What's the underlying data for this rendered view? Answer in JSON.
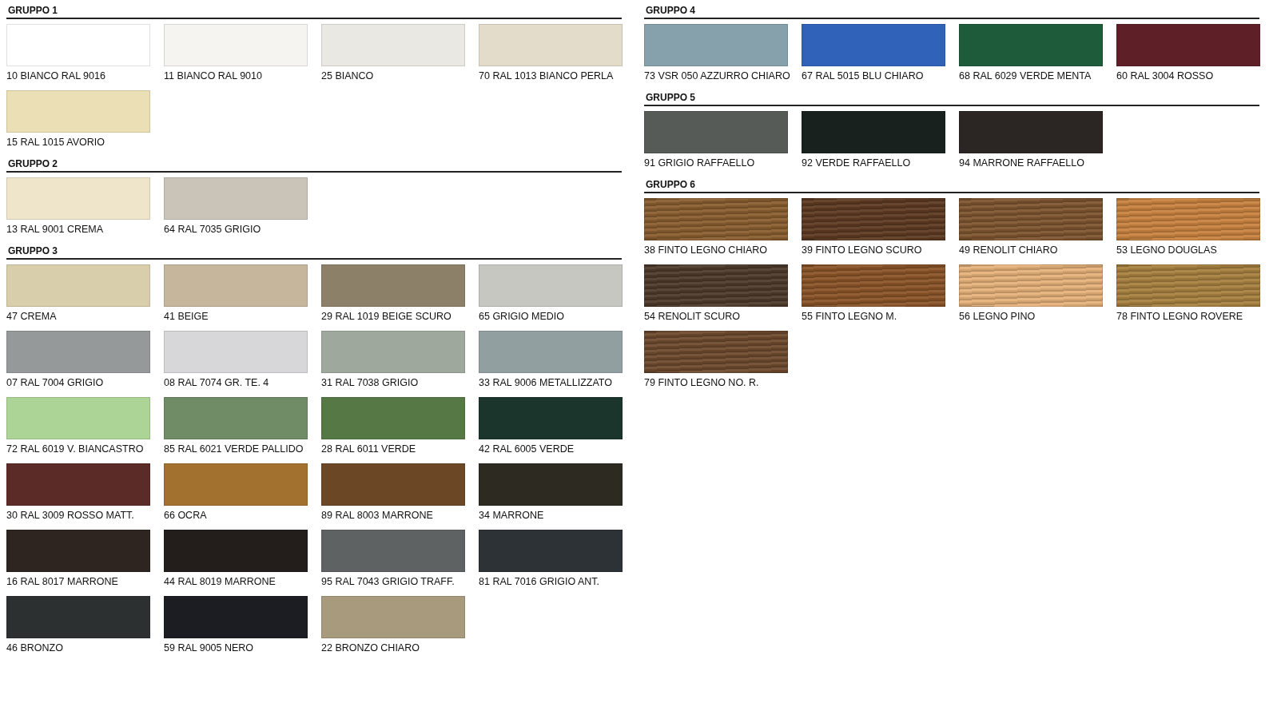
{
  "columns": [
    {
      "groups": [
        {
          "title": "GRUPPO 1",
          "swatches": [
            {
              "label": "10 BIANCO RAL 9016",
              "color": "#ffffff",
              "kind": "solid"
            },
            {
              "label": "11 BIANCO RAL 9010",
              "color": "#f5f4f0",
              "kind": "solid"
            },
            {
              "label": "25 BIANCO",
              "color": "#e9e8e2",
              "kind": "solid"
            },
            {
              "label": "70 RAL 1013 BIANCO PERLA",
              "color": "#e3dccb",
              "kind": "solid"
            },
            {
              "label": "15 RAL 1015 AVORIO",
              "color": "#ebdfb5",
              "kind": "solid"
            }
          ]
        },
        {
          "title": "GRUPPO 2",
          "swatches": [
            {
              "label": "13 RAL 9001 CREMA",
              "color": "#efe5cb",
              "kind": "solid"
            },
            {
              "label": "64 RAL 7035 GRIGIO",
              "color": "#c9c3b8",
              "kind": "solid"
            }
          ]
        },
        {
          "title": "GRUPPO 3",
          "swatches": [
            {
              "label": "47 CREMA",
              "color": "#d9ceac",
              "kind": "solid"
            },
            {
              "label": "41 BEIGE",
              "color": "#c5b69c",
              "kind": "solid"
            },
            {
              "label": "29 RAL 1019 BEIGE SCURO",
              "color": "#8c8068",
              "kind": "solid"
            },
            {
              "label": "65 GRIGIO MEDIO",
              "color": "#c7c7c2",
              "kind": "solid"
            },
            {
              "label": "07 RAL 7004 GRIGIO",
              "color": "#96999a",
              "kind": "solid"
            },
            {
              "label": "08 RAL 7074 GR. TE. 4",
              "color": "#d7d7da",
              "kind": "solid"
            },
            {
              "label": "31 RAL 7038 GRIGIO",
              "color": "#9ea89c",
              "kind": "solid"
            },
            {
              "label": "33 RAL 9006 METALLIZZATO",
              "color": "#929fa1",
              "kind": "solid"
            },
            {
              "label": "72 RAL 6019 V. BIANCASTRO",
              "color": "#acd496",
              "kind": "solid"
            },
            {
              "label": "85 RAL 6021 VERDE PALLIDO",
              "color": "#6f8c67",
              "kind": "solid"
            },
            {
              "label": "28 RAL 6011 VERDE",
              "color": "#567845",
              "kind": "solid"
            },
            {
              "label": "42 RAL 6005 VERDE",
              "color": "#1b352c",
              "kind": "solid"
            },
            {
              "label": "30 RAL 3009 ROSSO MATT.",
              "color": "#5b2c27",
              "kind": "solid"
            },
            {
              "label": "66 OCRA",
              "color": "#a2712f",
              "kind": "solid"
            },
            {
              "label": "89 RAL 8003 MARRONE",
              "color": "#6c4725",
              "kind": "solid"
            },
            {
              "label": "34 MARRONE",
              "color": "#2d2a22",
              "kind": "solid"
            },
            {
              "label": "16 RAL 8017 MARRONE",
              "color": "#2e2520",
              "kind": "solid"
            },
            {
              "label": "44 RAL 8019 MARRONE",
              "color": "#231e1c",
              "kind": "solid"
            },
            {
              "label": "95 RAL 7043 GRIGIO TRAFF.",
              "color": "#5e6262",
              "kind": "solid"
            },
            {
              "label": "81 RAL 7016 GRIGIO ANT.",
              "color": "#2d3236",
              "kind": "solid"
            },
            {
              "label": "46  BRONZO",
              "color": "#2c3030",
              "kind": "solid"
            },
            {
              "label": "59 RAL 9005 NERO",
              "color": "#1c1d22",
              "kind": "solid"
            },
            {
              "label": "22 BRONZO CHIARO",
              "color": "#a79a7d",
              "kind": "solid"
            }
          ]
        }
      ]
    },
    {
      "groups": [
        {
          "title": "GRUPPO 4",
          "swatches": [
            {
              "label": "73 VSR 050 AZZURRO CHIARO",
              "color": "#86a0ac",
              "kind": "solid"
            },
            {
              "label": "67 RAL 5015 BLU CHIARO",
              "color": "#2f62b8",
              "kind": "solid"
            },
            {
              "label": "68 RAL 6029 VERDE MENTA",
              "color": "#1e5b3a",
              "kind": "solid"
            },
            {
              "label": "60 RAL 3004 ROSSO",
              "color": "#5e1f27",
              "kind": "solid"
            }
          ]
        },
        {
          "title": "GRUPPO 5",
          "swatches": [
            {
              "label": "91 GRIGIO RAFFAELLO",
              "color": "#565b57",
              "kind": "solid"
            },
            {
              "label": "92 VERDE RAFFAELLO",
              "color": "#19211f",
              "kind": "solid"
            },
            {
              "label": "94 MARRONE RAFFAELLO",
              "color": "#2b2524",
              "kind": "solid"
            }
          ]
        },
        {
          "title": "GRUPPO 6",
          "swatches": [
            {
              "label": "38 FINTO LEGNO CHIARO",
              "color": "#8a5e30",
              "kind": "wood"
            },
            {
              "label": "39 FINTO LEGNO SCURO",
              "color": "#5e3a22",
              "kind": "wood"
            },
            {
              "label": "49 RENOLIT CHIARO",
              "color": "#7e5530",
              "kind": "wood"
            },
            {
              "label": "53 LEGNO DOUGLAS",
              "color": "#c88340",
              "kind": "wood"
            },
            {
              "label": "54 RENOLIT SCURO",
              "color": "#4e3b2c",
              "kind": "wood"
            },
            {
              "label": "55 FINTO LEGNO M.",
              "color": "#8b5428",
              "kind": "wood"
            },
            {
              "label": "56 LEGNO PINO",
              "color": "#e5b17a",
              "kind": "wood"
            },
            {
              "label": "78 FINTO LEGNO ROVERE",
              "color": "#a88140",
              "kind": "wood"
            },
            {
              "label": "79 FINTO LEGNO NO. R.",
              "color": "#6e4a2e",
              "kind": "wood"
            }
          ]
        }
      ]
    }
  ]
}
